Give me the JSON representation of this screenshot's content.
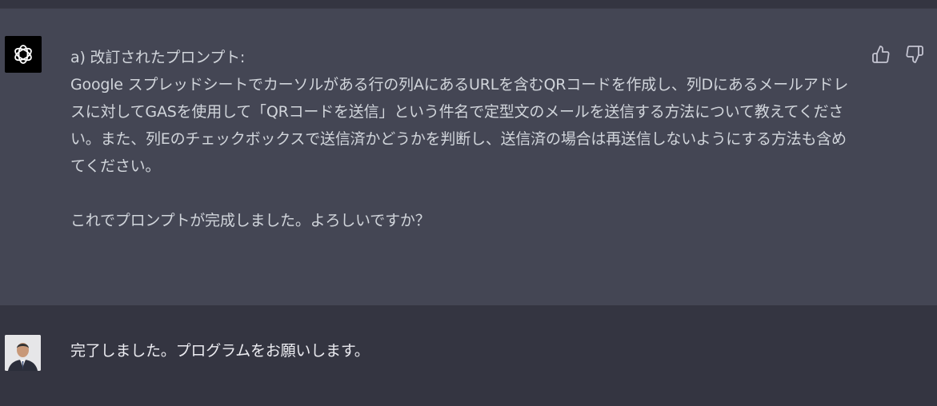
{
  "assistant_message": {
    "heading": "a) 改訂されたプロンプト:",
    "body": "Google スプレッドシートでカーソルがある行の列AにあるURLを含むQRコードを作成し、列Dにあるメールアドレスに対してGASを使用して「QRコードを送信」という件名で定型文のメールを送信する方法について教えてください。また、列Eのチェックボックスで送信済かどうかを判断し、送信済の場合は再送信しないようにする方法も含めてください。",
    "closing": "これでプロンプトが完成しました。よろしいですか？"
  },
  "user_message": {
    "text": "完了しました。プログラムをお願いします。"
  },
  "actions": {
    "thumbs_up_icon": "thumbs-up-icon",
    "thumbs_down_icon": "thumbs-down-icon"
  },
  "colors": {
    "assistant_bg": "#444654",
    "user_bg": "#343541",
    "text": "#d1d5db",
    "icon": "#acacbe"
  }
}
